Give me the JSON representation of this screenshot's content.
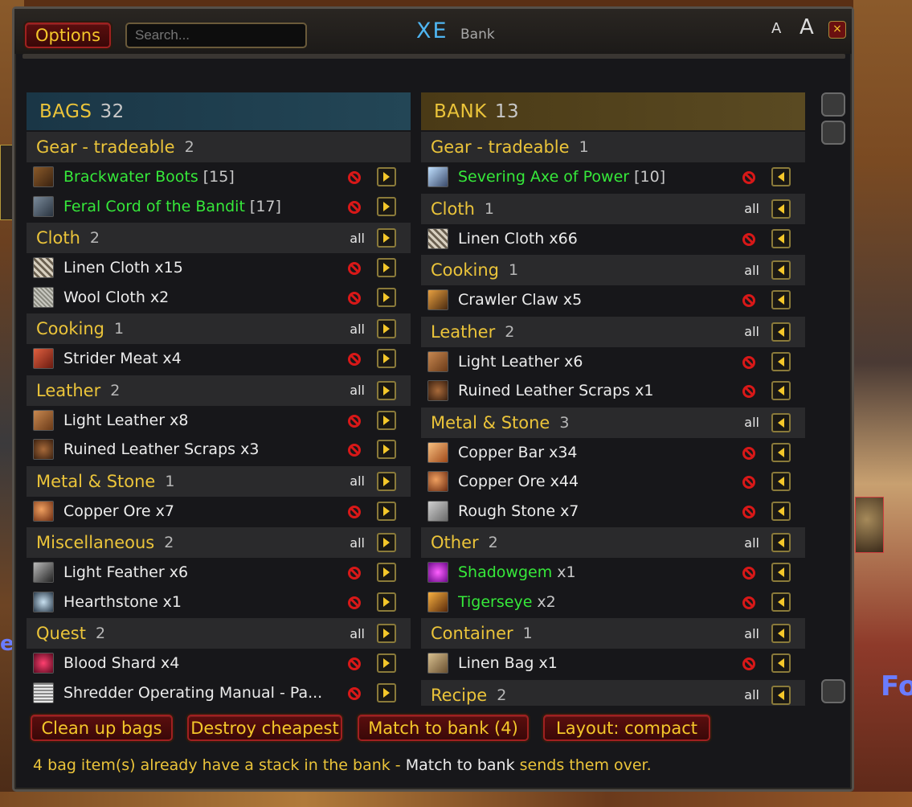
{
  "header": {
    "options_label": "Options",
    "search_placeholder": "Search...",
    "logo": "XE",
    "title": "Bank",
    "font_small": "A",
    "font_large": "A",
    "close": "×"
  },
  "bags": {
    "title": "BAGS",
    "count": "32",
    "categories": [
      {
        "name": "Gear - tradeable",
        "count": "2",
        "all": "",
        "items": [
          {
            "name": "Brackwater Boots",
            "suffix": "[15]",
            "green": true,
            "icon": "boots-icon"
          },
          {
            "name": "Feral Cord of the Bandit",
            "suffix": "[17]",
            "green": true,
            "icon": "belt-icon"
          }
        ]
      },
      {
        "name": "Cloth",
        "count": "2",
        "all": "all",
        "items": [
          {
            "name": "Linen Cloth x15",
            "suffix": "",
            "green": false,
            "icon": "linen-cloth-icon"
          },
          {
            "name": "Wool Cloth x2",
            "suffix": "",
            "green": false,
            "icon": "wool-cloth-icon"
          }
        ]
      },
      {
        "name": "Cooking",
        "count": "1",
        "all": "all",
        "items": [
          {
            "name": "Strider Meat x4",
            "suffix": "",
            "green": false,
            "icon": "meat-icon"
          }
        ]
      },
      {
        "name": "Leather",
        "count": "2",
        "all": "all",
        "items": [
          {
            "name": "Light Leather x8",
            "suffix": "",
            "green": false,
            "icon": "leather-icon"
          },
          {
            "name": "Ruined Leather Scraps x3",
            "suffix": "",
            "green": false,
            "icon": "leather-scraps-icon"
          }
        ]
      },
      {
        "name": "Metal & Stone",
        "count": "1",
        "all": "all",
        "items": [
          {
            "name": "Copper Ore x7",
            "suffix": "",
            "green": false,
            "icon": "ore-icon"
          }
        ]
      },
      {
        "name": "Miscellaneous",
        "count": "2",
        "all": "all",
        "items": [
          {
            "name": "Light Feather x6",
            "suffix": "",
            "green": false,
            "icon": "feather-icon"
          },
          {
            "name": "Hearthstone x1",
            "suffix": "",
            "green": false,
            "icon": "hearthstone-icon"
          }
        ]
      },
      {
        "name": "Quest",
        "count": "2",
        "all": "all",
        "items": [
          {
            "name": "Blood Shard x4",
            "suffix": "",
            "green": false,
            "icon": "shard-icon"
          },
          {
            "name": "Shredder Operating Manual - Pa...",
            "suffix": "",
            "green": false,
            "icon": "manual-icon"
          }
        ]
      }
    ]
  },
  "bank": {
    "title": "BANK",
    "count": "13",
    "categories": [
      {
        "name": "Gear - tradeable",
        "count": "1",
        "all": "",
        "items": [
          {
            "name": "Severing Axe of Power",
            "suffix": "[10]",
            "green": true,
            "icon": "axe-icon"
          }
        ]
      },
      {
        "name": "Cloth",
        "count": "1",
        "all": "all",
        "items": [
          {
            "name": "Linen Cloth x66",
            "suffix": "",
            "green": false,
            "icon": "linen-cloth-icon"
          }
        ]
      },
      {
        "name": "Cooking",
        "count": "1",
        "all": "all",
        "items": [
          {
            "name": "Crawler Claw x5",
            "suffix": "",
            "green": false,
            "icon": "claw-icon"
          }
        ]
      },
      {
        "name": "Leather",
        "count": "2",
        "all": "all",
        "items": [
          {
            "name": "Light Leather x6",
            "suffix": "",
            "green": false,
            "icon": "leather-icon"
          },
          {
            "name": "Ruined Leather Scraps x1",
            "suffix": "",
            "green": false,
            "icon": "leather-scraps-icon"
          }
        ]
      },
      {
        "name": "Metal & Stone",
        "count": "3",
        "all": "all",
        "items": [
          {
            "name": "Copper Bar x34",
            "suffix": "",
            "green": false,
            "icon": "bar-icon"
          },
          {
            "name": "Copper Ore x44",
            "suffix": "",
            "green": false,
            "icon": "ore-icon"
          },
          {
            "name": "Rough Stone x7",
            "suffix": "",
            "green": false,
            "icon": "stone-icon"
          }
        ]
      },
      {
        "name": "Other",
        "count": "2",
        "all": "all",
        "items": [
          {
            "name": "Shadowgem",
            "suffix": "x1",
            "green": true,
            "icon": "gem-icon"
          },
          {
            "name": "Tigerseye",
            "suffix": "x2",
            "green": true,
            "icon": "tigerseye-icon"
          }
        ]
      },
      {
        "name": "Container",
        "count": "1",
        "all": "all",
        "items": [
          {
            "name": "Linen Bag x1",
            "suffix": "",
            "green": false,
            "icon": "bag-icon"
          }
        ]
      },
      {
        "name": "Recipe",
        "count": "2",
        "all": "all",
        "items": []
      }
    ]
  },
  "footer": {
    "buttons": [
      "Clean up bags",
      "Destroy cheapest",
      "Match to bank (4)",
      "Layout: compact"
    ],
    "status_a": "4 bag item(s) already have a stack in the bank - ",
    "status_b": "Match to bank",
    "status_c": " sends them over."
  },
  "background": {
    "text_right": "Fo",
    "text_left": "e"
  },
  "colors": {
    "gold": "#ebc43a",
    "green": "#36e83a",
    "bags_header": "#1d3a4a",
    "bank_header": "#4a3a18",
    "no_red": "#d81818"
  }
}
